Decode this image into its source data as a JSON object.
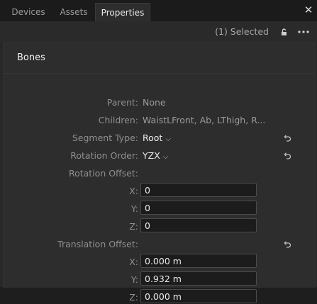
{
  "tabs": [
    {
      "label": "Devices",
      "active": false
    },
    {
      "label": "Assets",
      "active": false
    },
    {
      "label": "Properties",
      "active": true
    }
  ],
  "toolbar": {
    "selected_text": "(1) Selected",
    "icons": [
      "lock-icon",
      "more-icon"
    ]
  },
  "section": {
    "title": "Bones",
    "parent": {
      "label": "Parent:",
      "value": "None"
    },
    "children": {
      "label": "Children:",
      "value": "WaistLFront, Ab, LThigh, R..."
    },
    "segment_type": {
      "label": "Segment Type:",
      "value": "Root"
    },
    "rotation_order": {
      "label": "Rotation Order:",
      "value": "YZX"
    },
    "rotation_offset": {
      "label": "Rotation Offset:",
      "x": {
        "label": "X:",
        "value": "0"
      },
      "y": {
        "label": "Y:",
        "value": "0"
      },
      "z": {
        "label": "Z:",
        "value": "0"
      }
    },
    "translation_offset": {
      "label": "Translation Offset:",
      "x": {
        "label": "X:",
        "value": "0.000 m"
      },
      "y": {
        "label": "Y:",
        "value": "0.932 m"
      },
      "z": {
        "label": "Z:",
        "value": "0.000 m"
      }
    }
  },
  "colors": {
    "background": "#282828",
    "field": "#1c1c1c",
    "text_bright": "#ececec"
  }
}
